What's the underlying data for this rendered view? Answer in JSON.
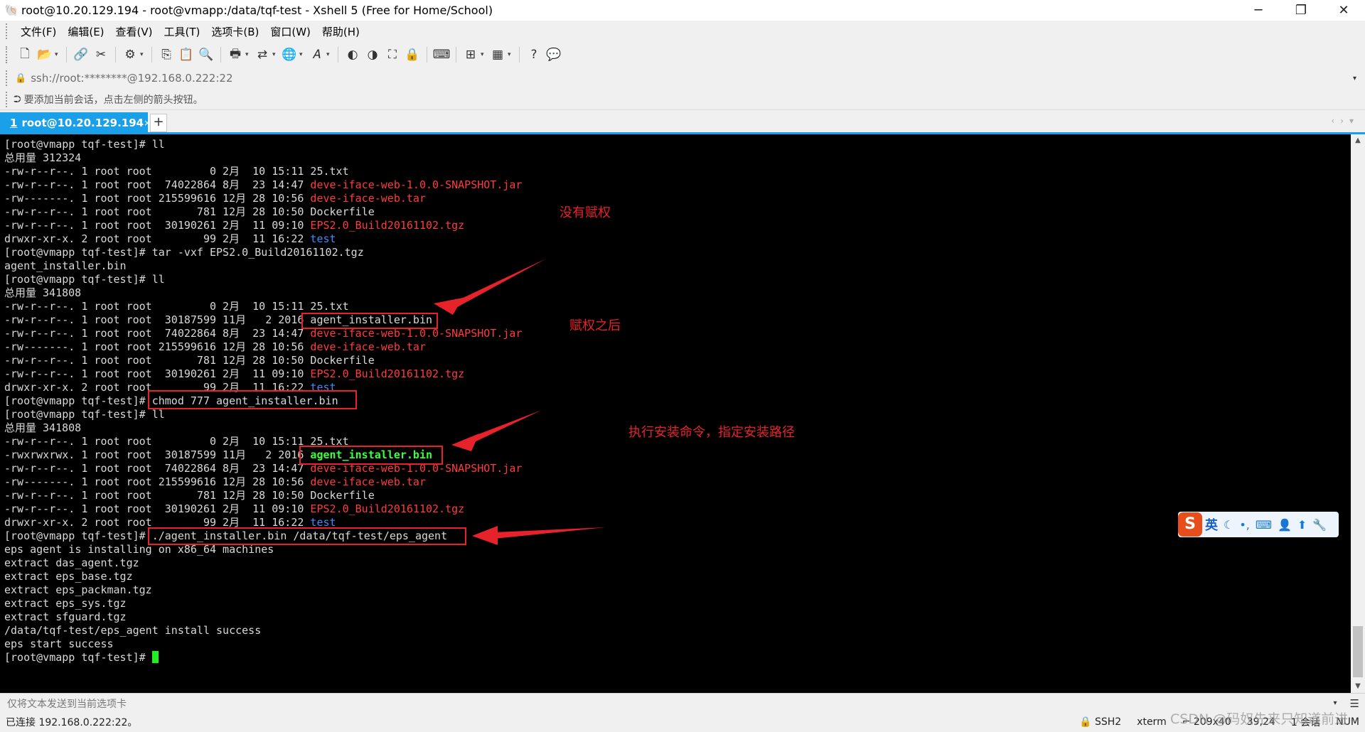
{
  "window": {
    "title": "root@10.20.129.194 - root@vmapp:/data/tqf-test - Xshell 5 (Free for Home/School)",
    "minimize": "─",
    "restore": "❐",
    "close": "✕"
  },
  "menu": [
    "文件(F)",
    "编辑(E)",
    "查看(V)",
    "工具(T)",
    "选项卡(B)",
    "窗口(W)",
    "帮助(H)"
  ],
  "address": {
    "value": "ssh://root:********@192.168.0.222:22"
  },
  "hint": "要添加当前会话，点击左侧的箭头按钮。",
  "tab": {
    "number": "1",
    "label": "root@10.20.129.194",
    "close": "×",
    "add": "+"
  },
  "terminal": {
    "lines": [
      [
        {
          "t": "[root@vmapp tqf-test]# ll",
          "c": "n"
        }
      ],
      [
        {
          "t": "总用量 312324",
          "c": "n"
        }
      ],
      [
        {
          "t": "-rw-r--r--. 1 root root         0 2月  10 15:11 25.txt",
          "c": "n"
        }
      ],
      [
        {
          "t": "-rw-r--r--. 1 root root  74022864 8月  23 14:47 ",
          "c": "n"
        },
        {
          "t": "deve-iface-web-1.0.0-SNAPSHOT.jar",
          "c": "r"
        }
      ],
      [
        {
          "t": "-rw-------. 1 root root 215599616 12月 28 10:56 ",
          "c": "n"
        },
        {
          "t": "deve-iface-web.tar",
          "c": "r"
        }
      ],
      [
        {
          "t": "-rw-r--r--. 1 root root       781 12月 28 10:50 Dockerfile",
          "c": "n"
        }
      ],
      [
        {
          "t": "-rw-r--r--. 1 root root  30190261 2月  11 09:10 ",
          "c": "n"
        },
        {
          "t": "EPS2.0_Build20161102.tgz",
          "c": "r"
        }
      ],
      [
        {
          "t": "drwxr-xr-x. 2 root root        99 2月  11 16:22 ",
          "c": "n"
        },
        {
          "t": "test",
          "c": "b"
        }
      ],
      [
        {
          "t": "[root@vmapp tqf-test]# tar -vxf EPS2.0_Build20161102.tgz",
          "c": "n"
        }
      ],
      [
        {
          "t": "agent_installer.bin",
          "c": "n"
        }
      ],
      [
        {
          "t": "[root@vmapp tqf-test]# ll",
          "c": "n"
        }
      ],
      [
        {
          "t": "总用量 341808",
          "c": "n"
        }
      ],
      [
        {
          "t": "-rw-r--r--. 1 root root         0 2月  10 15:11 25.txt",
          "c": "n"
        }
      ],
      [
        {
          "t": "-rw-r--r--. 1 root root  30187599 11月   2 2016 agent_installer.bin",
          "c": "n"
        }
      ],
      [
        {
          "t": "-rw-r--r--. 1 root root  74022864 8月  23 14:47 ",
          "c": "n"
        },
        {
          "t": "deve-iface-web-1.0.0-SNAPSHOT.jar",
          "c": "r"
        }
      ],
      [
        {
          "t": "-rw-------. 1 root root 215599616 12月 28 10:56 ",
          "c": "n"
        },
        {
          "t": "deve-iface-web.tar",
          "c": "r"
        }
      ],
      [
        {
          "t": "-rw-r--r--. 1 root root       781 12月 28 10:50 Dockerfile",
          "c": "n"
        }
      ],
      [
        {
          "t": "-rw-r--r--. 1 root root  30190261 2月  11 09:10 ",
          "c": "n"
        },
        {
          "t": "EPS2.0_Build20161102.tgz",
          "c": "r"
        }
      ],
      [
        {
          "t": "drwxr-xr-x. 2 root root        99 2月  11 16:22 ",
          "c": "n"
        },
        {
          "t": "test",
          "c": "b"
        }
      ],
      [
        {
          "t": "[root@vmapp tqf-test]# chmod 777 agent_installer.bin",
          "c": "n"
        }
      ],
      [
        {
          "t": "[root@vmapp tqf-test]# ll",
          "c": "n"
        }
      ],
      [
        {
          "t": "总用量 341808",
          "c": "n"
        }
      ],
      [
        {
          "t": "-rw-r--r--. 1 root root         0 2月  10 15:11 25.txt",
          "c": "n"
        }
      ],
      [
        {
          "t": "-rwxrwxrwx. 1 root root  30187599 11月   2 2016 ",
          "c": "n"
        },
        {
          "t": "agent_installer.bin",
          "c": "g"
        }
      ],
      [
        {
          "t": "-rw-r--r--. 1 root root  74022864 8月  23 14:47 ",
          "c": "n"
        },
        {
          "t": "deve-iface-web-1.0.0-SNAPSHOT.jar",
          "c": "r"
        }
      ],
      [
        {
          "t": "-rw-------. 1 root root 215599616 12月 28 10:56 ",
          "c": "n"
        },
        {
          "t": "deve-iface-web.tar",
          "c": "r"
        }
      ],
      [
        {
          "t": "-rw-r--r--. 1 root root       781 12月 28 10:50 Dockerfile",
          "c": "n"
        }
      ],
      [
        {
          "t": "-rw-r--r--. 1 root root  30190261 2月  11 09:10 ",
          "c": "n"
        },
        {
          "t": "EPS2.0_Build20161102.tgz",
          "c": "r"
        }
      ],
      [
        {
          "t": "drwxr-xr-x. 2 root root        99 2月  11 16:22 ",
          "c": "n"
        },
        {
          "t": "test",
          "c": "b"
        }
      ],
      [
        {
          "t": "[root@vmapp tqf-test]# ./agent_installer.bin /data/tqf-test/eps_agent",
          "c": "n"
        }
      ],
      [
        {
          "t": "eps agent is installing on x86_64 machines",
          "c": "n"
        }
      ],
      [
        {
          "t": "extract das_agent.tgz",
          "c": "n"
        }
      ],
      [
        {
          "t": "extract eps_base.tgz",
          "c": "n"
        }
      ],
      [
        {
          "t": "extract eps_packman.tgz",
          "c": "n"
        }
      ],
      [
        {
          "t": "extract eps_sys.tgz",
          "c": "n"
        }
      ],
      [
        {
          "t": "extract sfguard.tgz",
          "c": "n"
        }
      ],
      [
        {
          "t": "/data/tqf-test/eps_agent install success",
          "c": "n"
        }
      ],
      [
        {
          "t": "eps start success",
          "c": "n"
        }
      ],
      [
        {
          "t": "[root@vmapp tqf-test]# ",
          "c": "n"
        }
      ]
    ]
  },
  "annotations": {
    "note1": "没有赋权",
    "note2": "赋权之后",
    "note3": "执行安装命令，指定安装路径"
  },
  "ime": {
    "logo": "S",
    "lang": "英"
  },
  "send_bar": {
    "placeholder": "仅将文本发送到当前选项卡"
  },
  "status": {
    "connection": "已连接 192.168.0.222:22。",
    "protocol": "SSH2",
    "term": "xterm",
    "size": "209x40",
    "cursor": "39,24",
    "sessions": "1 会话",
    "numlock": "NUM"
  },
  "watermark": "CSDN @码奴先来只知道前进"
}
